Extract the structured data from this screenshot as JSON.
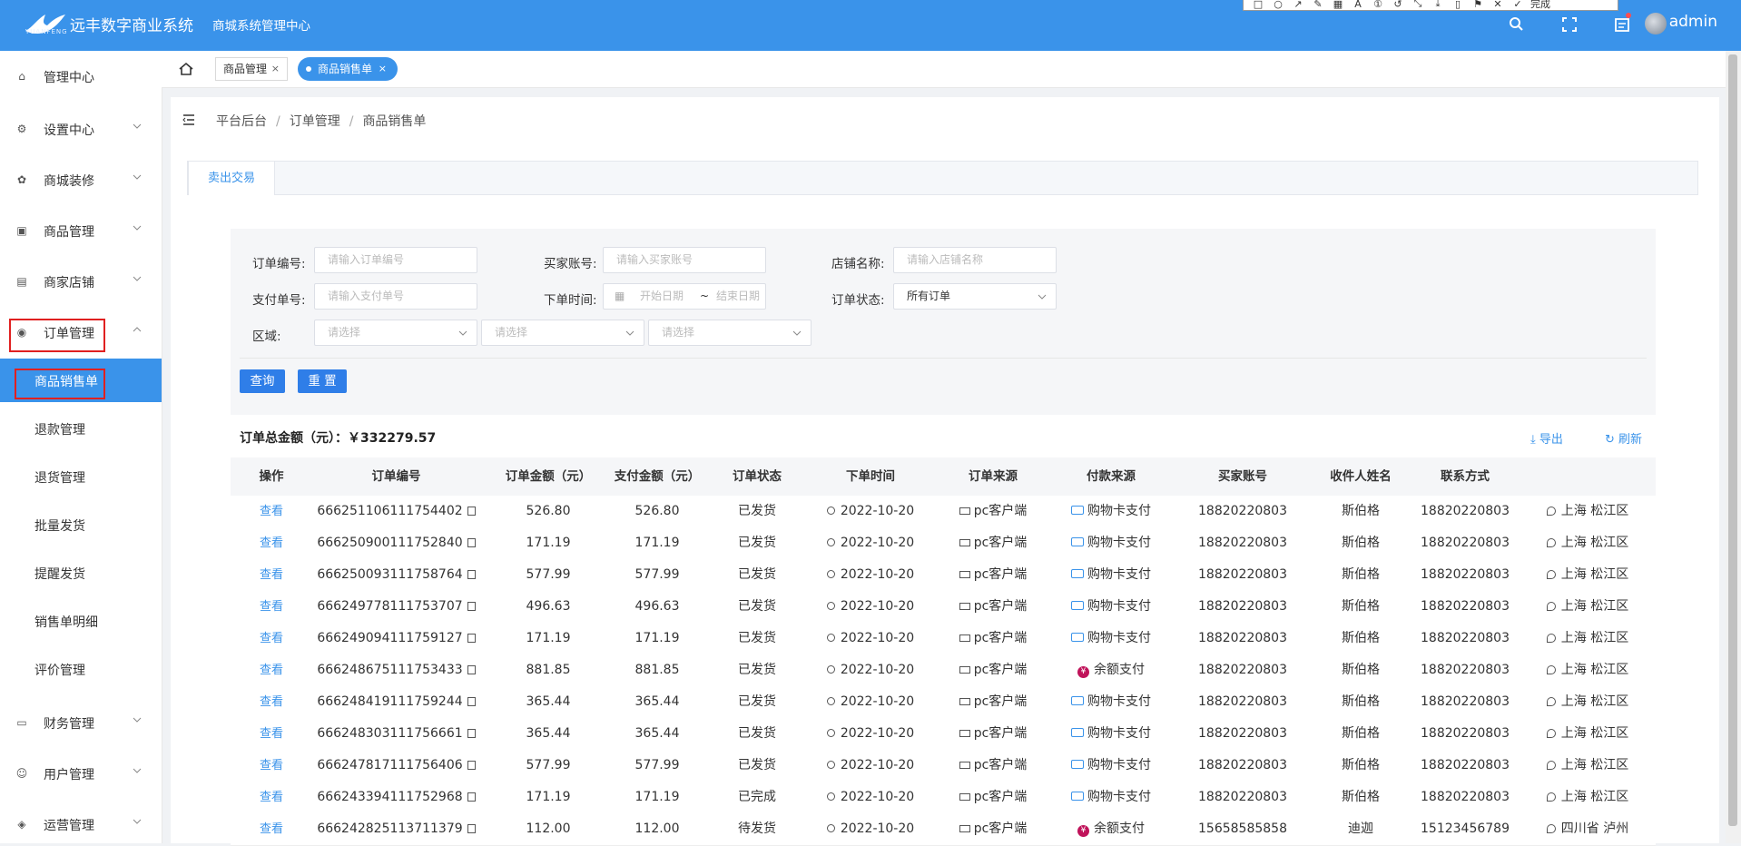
{
  "header": {
    "logo_text": "YUANFENG",
    "app_title": "远丰数字商业系统",
    "app_subtitle": "商城系统管理中心",
    "username": "admin",
    "annotation_done": "完成"
  },
  "sidebar": {
    "items": [
      {
        "label": "管理中心",
        "icon": "home-icon"
      },
      {
        "label": "设置中心",
        "icon": "gear-icon"
      },
      {
        "label": "商城装修",
        "icon": "decor-icon"
      },
      {
        "label": "商品管理",
        "icon": "goods-icon"
      },
      {
        "label": "商家店铺",
        "icon": "shop-icon"
      },
      {
        "label": "订单管理",
        "icon": "order-icon"
      },
      {
        "label": "财务管理",
        "icon": "finance-icon"
      },
      {
        "label": "用户管理",
        "icon": "user-icon"
      },
      {
        "label": "运营管理",
        "icon": "operate-icon"
      }
    ],
    "subitems": [
      "商品销售单",
      "退款管理",
      "退货管理",
      "批量发货",
      "提醒发货",
      "销售单明细",
      "评价管理"
    ]
  },
  "tabs": [
    {
      "label": "商品管理"
    },
    {
      "label": "商品销售单"
    }
  ],
  "breadcrumb": [
    "平台后台",
    "订单管理",
    "商品销售单"
  ],
  "content_tab": "卖出交易",
  "filters": {
    "order_no_label": "订单编号:",
    "order_no_placeholder": "请输入订单编号",
    "buyer_label": "买家账号:",
    "buyer_placeholder": "请输入买家账号",
    "shop_label": "店铺名称:",
    "shop_placeholder": "请输入店铺名称",
    "pay_no_label": "支付单号:",
    "pay_no_placeholder": "请输入支付单号",
    "time_label": "下单时间:",
    "start_placeholder": "开始日期",
    "range_sep": "~",
    "end_placeholder": "结束日期",
    "status_label": "订单状态:",
    "status_value": "所有订单",
    "region_label": "区域:",
    "region_placeholder": "请选择",
    "query_button": "查询",
    "reset_button": "重 置"
  },
  "summary": {
    "total_label": "订单总金额（元）：",
    "total_value": "￥332279.57",
    "export_label": "导出",
    "refresh_label": "刷新"
  },
  "table": {
    "headers": [
      "操作",
      "订单编号",
      "订单金额（元）",
      "支付金额（元）",
      "订单状态",
      "下单时间",
      "订单来源",
      "付款来源",
      "买家账号",
      "收件人姓名",
      "联系方式",
      ""
    ],
    "rows": [
      {
        "action": "查看",
        "order_no": "666251106111754402",
        "amount": "526.80",
        "paid": "526.80",
        "status": "已发货",
        "time": "2022-10-20",
        "source": "pc客户端",
        "pay_type": "card",
        "pay": "购物卡支付",
        "buyer": "18820220803",
        "receiver": "斯伯格",
        "phone": "18820220803",
        "region": "上海 松江区"
      },
      {
        "action": "查看",
        "order_no": "666250900111752840",
        "amount": "171.19",
        "paid": "171.19",
        "status": "已发货",
        "time": "2022-10-20",
        "source": "pc客户端",
        "pay_type": "card",
        "pay": "购物卡支付",
        "buyer": "18820220803",
        "receiver": "斯伯格",
        "phone": "18820220803",
        "region": "上海 松江区"
      },
      {
        "action": "查看",
        "order_no": "666250093111758764",
        "amount": "577.99",
        "paid": "577.99",
        "status": "已发货",
        "time": "2022-10-20",
        "source": "pc客户端",
        "pay_type": "card",
        "pay": "购物卡支付",
        "buyer": "18820220803",
        "receiver": "斯伯格",
        "phone": "18820220803",
        "region": "上海 松江区"
      },
      {
        "action": "查看",
        "order_no": "666249778111753707",
        "amount": "496.63",
        "paid": "496.63",
        "status": "已发货",
        "time": "2022-10-20",
        "source": "pc客户端",
        "pay_type": "card",
        "pay": "购物卡支付",
        "buyer": "18820220803",
        "receiver": "斯伯格",
        "phone": "18820220803",
        "region": "上海 松江区"
      },
      {
        "action": "查看",
        "order_no": "666249094111759127",
        "amount": "171.19",
        "paid": "171.19",
        "status": "已发货",
        "time": "2022-10-20",
        "source": "pc客户端",
        "pay_type": "card",
        "pay": "购物卡支付",
        "buyer": "18820220803",
        "receiver": "斯伯格",
        "phone": "18820220803",
        "region": "上海 松江区"
      },
      {
        "action": "查看",
        "order_no": "666248675111753433",
        "amount": "881.85",
        "paid": "881.85",
        "status": "已发货",
        "time": "2022-10-20",
        "source": "pc客户端",
        "pay_type": "balance",
        "pay": "余额支付",
        "buyer": "18820220803",
        "receiver": "斯伯格",
        "phone": "18820220803",
        "region": "上海 松江区"
      },
      {
        "action": "查看",
        "order_no": "666248419111759244",
        "amount": "365.44",
        "paid": "365.44",
        "status": "已发货",
        "time": "2022-10-20",
        "source": "pc客户端",
        "pay_type": "card",
        "pay": "购物卡支付",
        "buyer": "18820220803",
        "receiver": "斯伯格",
        "phone": "18820220803",
        "region": "上海 松江区"
      },
      {
        "action": "查看",
        "order_no": "666248303111756661",
        "amount": "365.44",
        "paid": "365.44",
        "status": "已发货",
        "time": "2022-10-20",
        "source": "pc客户端",
        "pay_type": "card",
        "pay": "购物卡支付",
        "buyer": "18820220803",
        "receiver": "斯伯格",
        "phone": "18820220803",
        "region": "上海 松江区"
      },
      {
        "action": "查看",
        "order_no": "666247817111756406",
        "amount": "577.99",
        "paid": "577.99",
        "status": "已发货",
        "time": "2022-10-20",
        "source": "pc客户端",
        "pay_type": "card",
        "pay": "购物卡支付",
        "buyer": "18820220803",
        "receiver": "斯伯格",
        "phone": "18820220803",
        "region": "上海 松江区"
      },
      {
        "action": "查看",
        "order_no": "666243394111752968",
        "amount": "171.19",
        "paid": "171.19",
        "status": "已完成",
        "time": "2022-10-20",
        "source": "pc客户端",
        "pay_type": "card",
        "pay": "购物卡支付",
        "buyer": "18820220803",
        "receiver": "斯伯格",
        "phone": "18820220803",
        "region": "上海 松江区"
      },
      {
        "action": "查看",
        "order_no": "666242825113711379",
        "amount": "112.00",
        "paid": "112.00",
        "status": "待发货",
        "time": "2022-10-20",
        "source": "pc客户端",
        "pay_type": "balance",
        "pay": "余额支付",
        "buyer": "15658585858",
        "receiver": "迪迦",
        "phone": "15123456789",
        "region": "四川省 泸州"
      }
    ]
  },
  "colors": {
    "primary": "#3a93ea",
    "highlight": "#e02020"
  }
}
